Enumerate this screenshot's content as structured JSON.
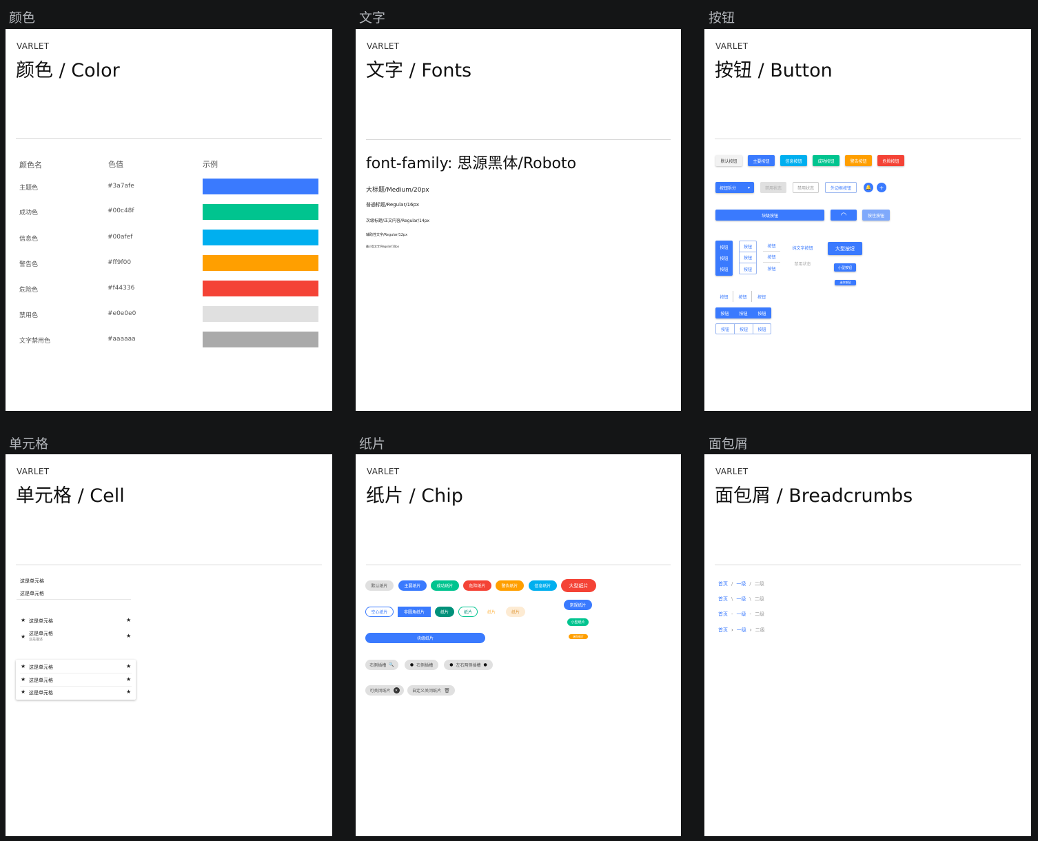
{
  "labels": {
    "color": "颜色",
    "fonts": "文字",
    "button": "按钮",
    "cell": "单元格",
    "chip": "纸片",
    "breadcrumbs": "面包屑"
  },
  "brand": "VARLET",
  "titles": {
    "color": "颜色 / Color",
    "fonts": "文字 / Fonts",
    "button": "按钮 / Button",
    "cell": "单元格 / Cell",
    "chip": "纸片 / Chip",
    "breadcrumbs": "面包屑 / Breadcrumbs"
  },
  "colorTable": {
    "headers": [
      "颜色名",
      "色值",
      "示例"
    ],
    "rows": [
      {
        "name": "主题色",
        "value": "#3a7afe"
      },
      {
        "name": "成功色",
        "value": "#00c48f"
      },
      {
        "name": "信息色",
        "value": "#00afef"
      },
      {
        "name": "警告色",
        "value": "#ff9f00"
      },
      {
        "name": "危险色",
        "value": "#f44336"
      },
      {
        "name": "禁用色",
        "value": "#e0e0e0"
      },
      {
        "name": "文字禁用色",
        "value": "#aaaaaa"
      }
    ]
  },
  "fonts": {
    "family": "font-family: 思源黑体/Roboto",
    "samples": [
      "大标题/Medium/20px",
      "普通标题/Regular/16px",
      "次级标题/正文内容/Regular/14px",
      "辅助性文字/Regular/12px",
      "最小型文字/Regular/10px"
    ]
  },
  "buttons": {
    "row1": [
      "默认按钮",
      "主要按钮",
      "信息按钮",
      "成功按钮",
      "警告按钮",
      "危险按钮"
    ],
    "split": "按钮拆分",
    "split_arrow": "▾",
    "disabled": "禁用状态",
    "disabled_outline": "禁用状态",
    "outline": "外边框按钮",
    "bell": "🔔",
    "plus": "+",
    "block": "块级按钮",
    "loading": "◠",
    "pressed": "按住按钮",
    "btn": "按钮",
    "text_btn": "纯文字按钮",
    "text_disabled": "禁用状态",
    "large": "大型按钮",
    "small": "小型按钮",
    "mini": "迷你按钮"
  },
  "cell": {
    "plain": [
      "这是单元格",
      "这是单元格"
    ],
    "icon_cell": "这是单元格",
    "desc_title": "这是单元格",
    "desc": "这是描述",
    "card_rows": [
      "这是单元格",
      "这是单元格",
      "这是单元格"
    ],
    "star": "★"
  },
  "chip": {
    "row1": [
      "默认纸片",
      "主要纸片",
      "成功纸片",
      "危险纸片",
      "警告纸片",
      "信息纸片",
      "大型纸片"
    ],
    "row2": [
      "空心纸片",
      "非圆角纸片",
      "纸片",
      "纸片",
      "纸片",
      "纸片"
    ],
    "normal": "常规纸片",
    "small": "小型纸片",
    "mini": "迷你纸片",
    "block": "块级纸片",
    "right_icon": "右侧插槽",
    "left_icon": "右侧插槽",
    "both_icon": "左右两侧插槽",
    "closable": "可关闭纸片",
    "custom_close": "自定义关闭纸片",
    "search_icon": "🔍",
    "dot_icon": "●",
    "close_icon": "✕",
    "trash_icon": "🗑"
  },
  "breadcrumbs": {
    "items": [
      "首页",
      "一级",
      "二级"
    ],
    "separators": [
      "/",
      "\\",
      "-",
      "›"
    ]
  },
  "colors": {
    "primary": "#3a7afe",
    "success": "#00c48f",
    "info": "#00afef",
    "warning": "#ff9f00",
    "danger": "#f44336",
    "disabled": "#e0e0e0",
    "text_disabled": "#aaaaaa"
  }
}
